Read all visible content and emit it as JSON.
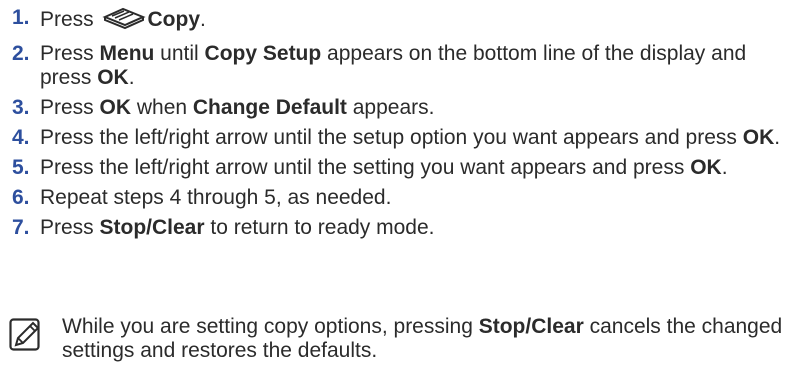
{
  "steps": [
    {
      "num": "1.",
      "parts": [
        {
          "t": "Press "
        },
        {
          "t": "",
          "icon": "copy-icon"
        },
        {
          "t": "Copy",
          "b": true
        },
        {
          "t": "."
        }
      ]
    },
    {
      "num": "2.",
      "parts": [
        {
          "t": "Press "
        },
        {
          "t": "Menu",
          "b": true
        },
        {
          "t": " until "
        },
        {
          "t": "Copy Setup",
          "b": true
        },
        {
          "t": " appears on the bottom line of the display and press "
        },
        {
          "t": "OK",
          "b": true
        },
        {
          "t": "."
        }
      ]
    },
    {
      "num": "3.",
      "parts": [
        {
          "t": "Press "
        },
        {
          "t": "OK",
          "b": true
        },
        {
          "t": " when "
        },
        {
          "t": "Change Default",
          "b": true
        },
        {
          "t": " appears."
        }
      ]
    },
    {
      "num": "4.",
      "parts": [
        {
          "t": "Press the left/right arrow until the setup option you want appears and press "
        },
        {
          "t": "OK",
          "b": true
        },
        {
          "t": "."
        }
      ]
    },
    {
      "num": "5.",
      "parts": [
        {
          "t": "Press the left/right arrow until the setting you want appears and press "
        },
        {
          "t": "OK",
          "b": true
        },
        {
          "t": "."
        }
      ]
    },
    {
      "num": "6.",
      "parts": [
        {
          "t": "Repeat steps 4 through 5, as needed."
        }
      ]
    },
    {
      "num": "7.",
      "parts": [
        {
          "t": "Press "
        },
        {
          "t": "Stop/Clear",
          "b": true
        },
        {
          "t": " to return to ready mode."
        }
      ]
    }
  ],
  "note": {
    "icon": "note-pencil-icon",
    "parts": [
      {
        "t": "While you are setting copy options, pressing "
      },
      {
        "t": "Stop/Clear",
        "b": true
      },
      {
        "t": " cancels the changed settings and restores the defaults."
      }
    ]
  },
  "colors": {
    "step_number": "#2d4f9e",
    "text": "#2b2b2b"
  }
}
